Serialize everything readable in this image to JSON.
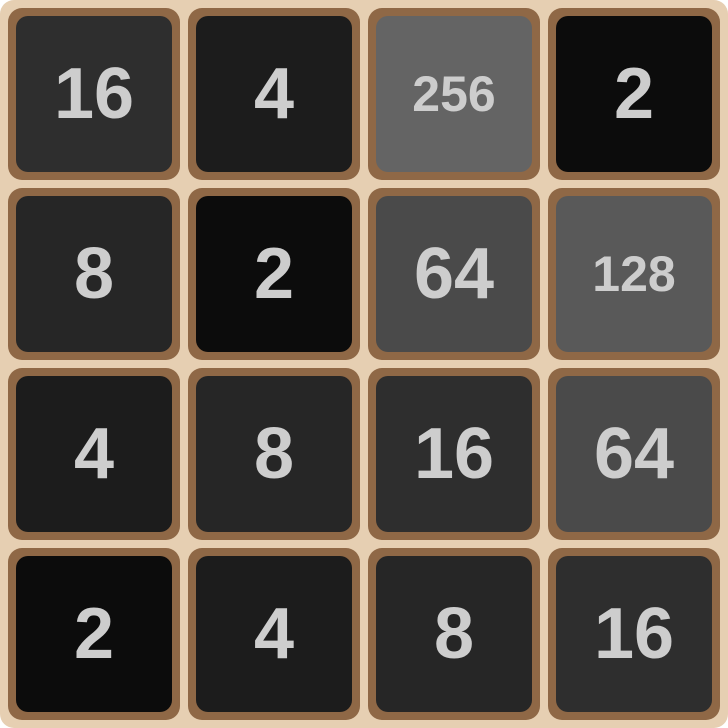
{
  "board": {
    "rows": [
      [
        {
          "value": "16",
          "color": "#2e2e2e"
        },
        {
          "value": "4",
          "color": "#1c1c1c"
        },
        {
          "value": "256",
          "color": "#646464"
        },
        {
          "value": "2",
          "color": "#0c0c0c"
        }
      ],
      [
        {
          "value": "8",
          "color": "#262626"
        },
        {
          "value": "2",
          "color": "#0c0c0c"
        },
        {
          "value": "64",
          "color": "#4a4a4a"
        },
        {
          "value": "128",
          "color": "#595959"
        }
      ],
      [
        {
          "value": "4",
          "color": "#1c1c1c"
        },
        {
          "value": "8",
          "color": "#262626"
        },
        {
          "value": "16",
          "color": "#2e2e2e"
        },
        {
          "value": "64",
          "color": "#4a4a4a"
        }
      ],
      [
        {
          "value": "2",
          "color": "#0c0c0c"
        },
        {
          "value": "4",
          "color": "#1c1c1c"
        },
        {
          "value": "8",
          "color": "#262626"
        },
        {
          "value": "16",
          "color": "#2e2e2e"
        }
      ]
    ]
  }
}
